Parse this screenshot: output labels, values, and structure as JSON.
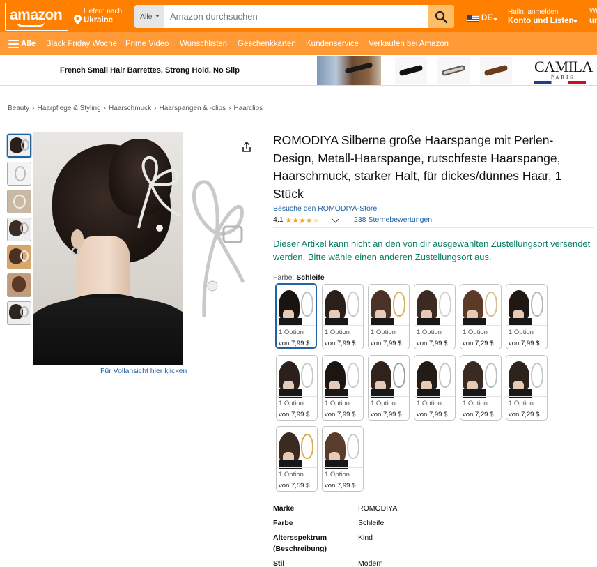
{
  "header": {
    "logo": "amazon",
    "deliver_line1": "Liefern nach",
    "deliver_line2": "Ukraine",
    "search_dept": "Alle",
    "search_placeholder": "Amazon durchsuchen",
    "lang": "DE",
    "account_line1": "Hallo, anmelden",
    "account_line2": "Konto und Listen",
    "returns_line1": "Waren",
    "returns_line2": "und"
  },
  "nav": {
    "all_label": "Alle",
    "links": [
      "Black Friday Woche",
      "Prime Video",
      "Wunschlisten",
      "Geschenkkarten",
      "Kundenservice",
      "Verkaufen bei Amazon"
    ]
  },
  "banner": {
    "text": "French Small Hair Barrettes, Strong Hold, No Slip",
    "brand": "CAMILA",
    "brand_sub": "PARIS"
  },
  "breadcrumb": [
    "Beauty",
    "Haarpflege & Styling",
    "Haarschmuck",
    "Haarspangen & -clips",
    "Haarclips"
  ],
  "gallery": {
    "view_full": "Für Vollansicht hier klicken"
  },
  "product": {
    "title": "ROMODIYA Silberne große Haarspange mit Perlen-Design, Metall-Haarspange, rutschfeste Haarspange, Haarschmuck, starker Halt, für dickes/dünnes Haar, 1 Stück",
    "store_link": "Besuche den ROMODIYA-Store",
    "rating_value": "4,1",
    "stars_filled": 4,
    "rating_count": "238 Sternebewertungen",
    "shipping_warning": "Dieser Artikel kann nicht an den von dir ausgewählten Zustellungsort versendet werden. Bitte wähle einen anderen Zustellungsort aus.",
    "color_label": "Farbe:",
    "color_value": "Schleife"
  },
  "swatches": [
    {
      "option": "1 Option",
      "price": "von 7,99 $"
    },
    {
      "option": "1 Option",
      "price": "von 7,99 $"
    },
    {
      "option": "1 Option",
      "price": "von 7,99 $"
    },
    {
      "option": "1 Option",
      "price": "von 7,99 $"
    },
    {
      "option": "1 Option",
      "price": "von 7,29 $"
    },
    {
      "option": "1 Option",
      "price": "von 7,99 $"
    },
    {
      "option": "1 Option",
      "price": "von 7,99 $"
    },
    {
      "option": "1 Option",
      "price": "von 7,99 $"
    },
    {
      "option": "1 Option",
      "price": "von 7,99 $"
    },
    {
      "option": "1 Option",
      "price": "von 7,99 $"
    },
    {
      "option": "1 Option",
      "price": "von 7,29 $"
    },
    {
      "option": "1 Option",
      "price": "von 7,29 $"
    },
    {
      "option": "1 Option",
      "price": "von 7,59 $"
    },
    {
      "option": "1 Option",
      "price": "von 7,99 $"
    }
  ],
  "specs": [
    {
      "key": "Marke",
      "value": "ROMODIYA"
    },
    {
      "key": "Farbe",
      "value": "Schleife"
    },
    {
      "key": "Altersspektrum (Beschreibung)",
      "value": "Kind"
    },
    {
      "key": "Stil",
      "value": "Modern"
    }
  ],
  "colors": {
    "nav_top": "#ff7f00",
    "nav_bottom": "#ff9a36",
    "search_button": "#febd69",
    "link": "#2162a1",
    "success": "#067d62",
    "star": "#f5a623"
  }
}
